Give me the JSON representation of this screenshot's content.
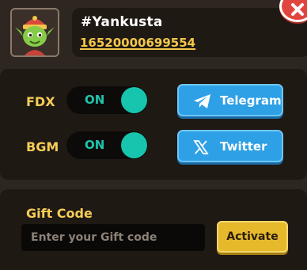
{
  "profile": {
    "avatar_icon": "goblin-avatar-icon",
    "username": "#Yankusta",
    "user_id": "16520000699554"
  },
  "close_icon": "close-icon",
  "settings": {
    "fdx": {
      "label": "FDX",
      "state": "ON"
    },
    "bgm": {
      "label": "BGM",
      "state": "ON"
    },
    "telegram": {
      "label": "Telegram",
      "icon": "telegram-icon"
    },
    "twitter": {
      "label": "Twitter",
      "icon": "x-logo-icon"
    }
  },
  "gift": {
    "title": "Gift Code",
    "placeholder": "Enter your Gift code",
    "value": "",
    "activate_label": "Activate"
  },
  "colors": {
    "background": "#2e2621",
    "panel": "#1f1914",
    "label_yellow": "#f6cd57",
    "toggle_teal": "#17c4ad",
    "social_blue": "#2ea0e6",
    "activate_gold": "#e6b92d",
    "close_red": "#e1463e"
  }
}
